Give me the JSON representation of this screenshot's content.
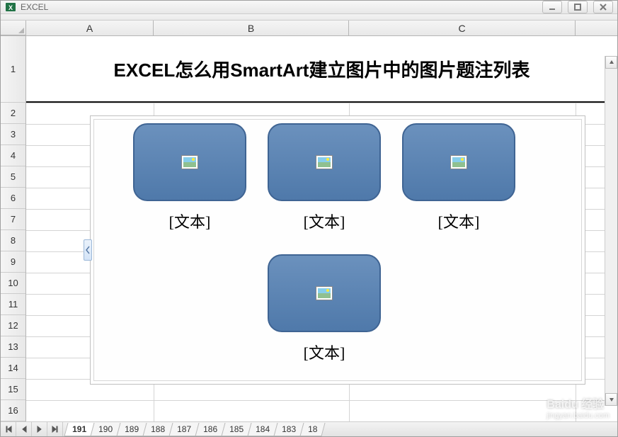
{
  "window": {
    "title": "EXCEL"
  },
  "columns": [
    "A",
    "B",
    "C"
  ],
  "rows": [
    1,
    2,
    3,
    4,
    5,
    6,
    7,
    8,
    9,
    10,
    11,
    12,
    13,
    14,
    15,
    16
  ],
  "title_cell": "EXCEL怎么用SmartArt建立图片中的图片题注列表",
  "smartart": {
    "items": [
      {
        "caption": "[文本]"
      },
      {
        "caption": "[文本]"
      },
      {
        "caption": "[文本]"
      },
      {
        "caption": "[文本]"
      }
    ]
  },
  "sheet_tabs": [
    "191",
    "190",
    "189",
    "188",
    "187",
    "186",
    "185",
    "184",
    "183",
    "18"
  ],
  "active_tab": "191",
  "watermark": {
    "brand": "Baidu 经验",
    "url": "jingyan.baidu.com"
  }
}
